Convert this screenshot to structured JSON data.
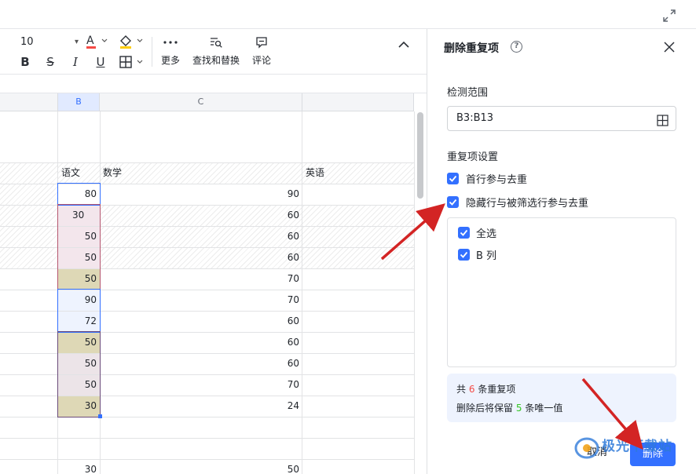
{
  "toolbar": {
    "font_size": "10",
    "more_label": "更多",
    "find_replace_label": "查找和替换",
    "comment_label": "评论"
  },
  "sheet": {
    "col_headers": [
      "B",
      "C"
    ],
    "header_row": {
      "b": "语文",
      "c": "数学",
      "d": "英语"
    },
    "rows": [
      {
        "b": "80",
        "c": "90"
      },
      {
        "b": "30",
        "c": "60"
      },
      {
        "b": "50",
        "c": "60"
      },
      {
        "b": "50",
        "c": "60"
      },
      {
        "b": "50",
        "c": "70"
      },
      {
        "b": "90",
        "c": "70"
      },
      {
        "b": "72",
        "c": "60"
      },
      {
        "b": "50",
        "c": "60"
      },
      {
        "b": "50",
        "c": "60"
      },
      {
        "b": "50",
        "c": "70"
      },
      {
        "b": "30",
        "c": "24"
      }
    ],
    "bottom_row": {
      "b": "30",
      "c": "50"
    }
  },
  "panel": {
    "title": "删除重复项",
    "help_icon": "?",
    "range_label": "检测范围",
    "range_value": "B3:B13",
    "settings_label": "重复项设置",
    "opt_first_row": "首行参与去重",
    "opt_hidden_rows": "隐藏行与被筛选行参与去重",
    "select_all": "全选",
    "col_b": "B 列",
    "summary": {
      "l1_pre": "共",
      "dup_count": "6",
      "l1_post": "条重复项",
      "l2_pre": "删除后将保留",
      "keep_count": "5",
      "l2_post": "条唯一值"
    },
    "cancel": "取消",
    "delete": "删除"
  },
  "watermark": "极光下载站",
  "colors": {
    "accent": "#3370ff",
    "dup_pink": "#f3e6ec",
    "dup_olive": "#ded8b6",
    "unique_blue": "#eef3fe",
    "arrow_red": "#d32424"
  }
}
